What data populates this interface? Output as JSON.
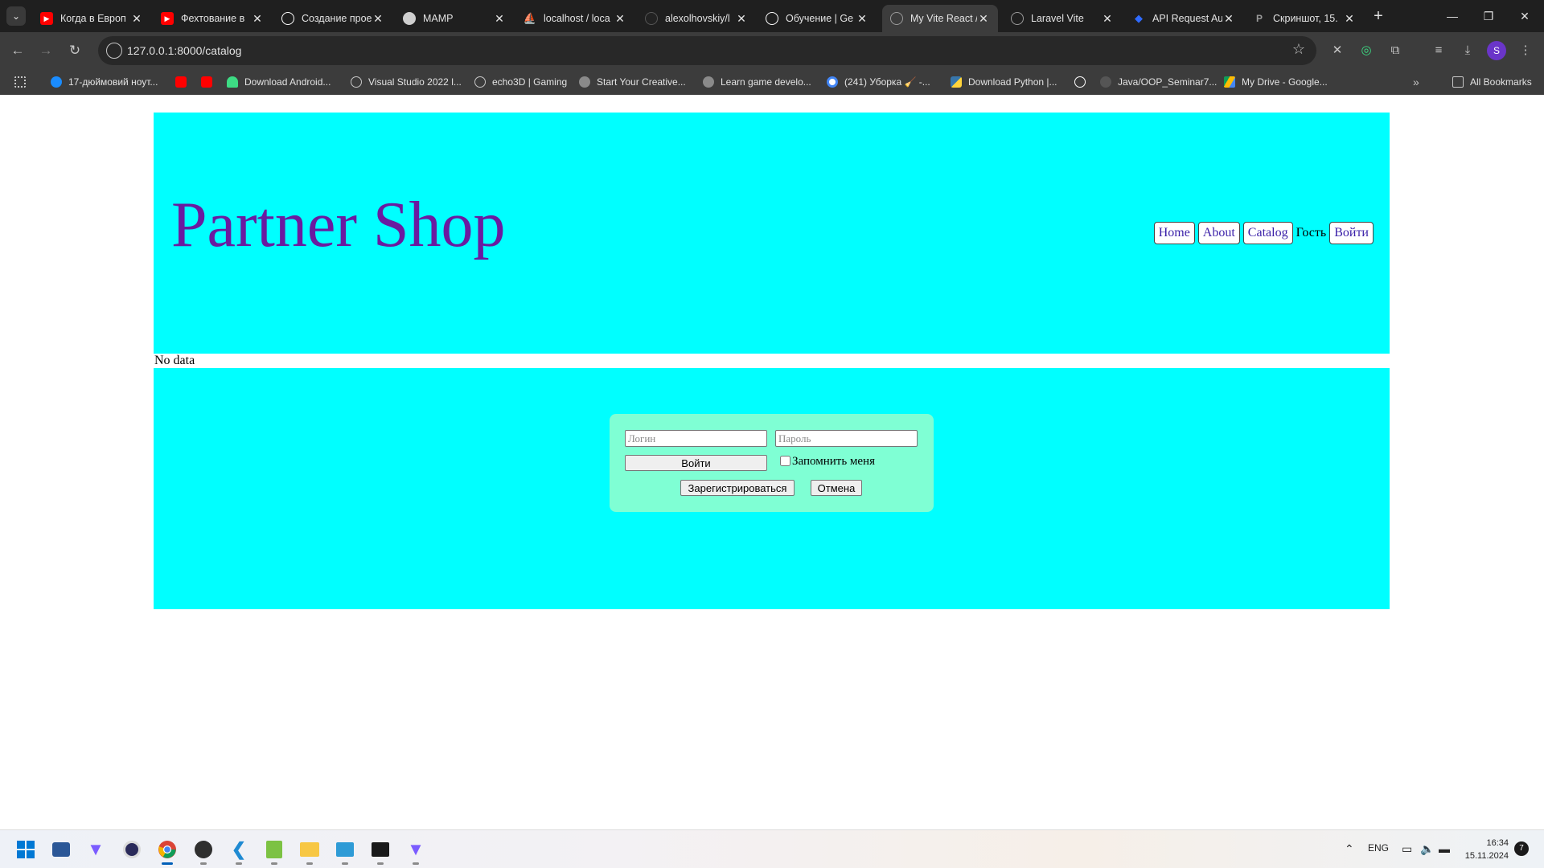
{
  "browser": {
    "tabs": [
      {
        "title": "Когда в Европ",
        "favicon": "youtube-icon",
        "color": "#ff0000",
        "active": false
      },
      {
        "title": "Фехтование в",
        "favicon": "youtube-icon",
        "color": "#ff0000",
        "active": false
      },
      {
        "title": "Создание прое",
        "favicon": "chatgpt-icon",
        "color": "#ffffff",
        "active": false
      },
      {
        "title": "MAMP",
        "favicon": "mamp-icon",
        "color": "#cfcfcf",
        "active": false
      },
      {
        "title": "localhost / loca",
        "favicon": "phpmyadmin-icon",
        "color": "#f29111",
        "active": false
      },
      {
        "title": "alexolhovskiy/l",
        "favicon": "github-icon",
        "color": "#222222",
        "active": false
      },
      {
        "title": "Обучение | Ge",
        "favicon": "chatgpt-icon",
        "color": "#ffffff",
        "active": false
      },
      {
        "title": "My Vite React /",
        "favicon": "globe-icon",
        "color": "#9a9a9a",
        "active": true
      },
      {
        "title": "Laravel Vite",
        "favicon": "globe-icon",
        "color": "#9a9a9a",
        "active": false
      },
      {
        "title": "API Request Au",
        "favicon": "dropbox-icon",
        "color": "#2f6bff",
        "active": false
      },
      {
        "title": "Скриншот, 15.",
        "favicon": "p-icon",
        "color": "#9a9a9a",
        "active": false
      }
    ],
    "url": "127.0.0.1:8000/catalog",
    "profile_initial": "S",
    "bookmarks": [
      {
        "label": "17-дюймовий ноут...",
        "icon": "hp-icon",
        "color": "#1a8cff"
      },
      {
        "label": "",
        "icon": "youtube-icon",
        "color": "#ff0000"
      },
      {
        "label": "",
        "icon": "youtube-icon",
        "color": "#ff0000"
      },
      {
        "label": "Download Android...",
        "icon": "android-icon",
        "color": "#3ddc84"
      },
      {
        "label": "Visual Studio 2022 l...",
        "icon": "globe-icon",
        "color": "#c7c7c7"
      },
      {
        "label": "echo3D | Gaming",
        "icon": "globe-icon",
        "color": "#c7c7c7"
      },
      {
        "label": "Start Your Creative...",
        "icon": "unity-icon",
        "color": "#c7c7c7"
      },
      {
        "label": "Learn game develo...",
        "icon": "unity-icon",
        "color": "#c7c7c7"
      },
      {
        "label": "(241) Уборка 🧹 -...",
        "icon": "google-icon",
        "color": "#ffffff"
      },
      {
        "label": "Download Python |...",
        "icon": "python-icon",
        "color": "#3776ab"
      },
      {
        "label": "",
        "icon": "chatgpt-icon",
        "color": "#ffffff"
      },
      {
        "label": "Java/OOP_Seminar7...",
        "icon": "github-icon",
        "color": "#555555"
      },
      {
        "label": "My Drive - Google...",
        "icon": "drive-icon",
        "color": "#fbbc04"
      }
    ],
    "all_bookmarks_label": "All Bookmarks"
  },
  "site": {
    "title": "Partner Shop",
    "nav": {
      "home": "Home",
      "about": "About",
      "catalog": "Catalog",
      "guest": "Гость",
      "login": "Войти"
    },
    "no_data": "No data",
    "login_form": {
      "login_placeholder": "Логин",
      "password_placeholder": "Пароль",
      "submit_label": "Войти",
      "remember_label": "Запомнить меня",
      "register_label": "Зарегистрироваться",
      "cancel_label": "Отмена"
    },
    "colors": {
      "header_bg": "#00ffff",
      "title_color": "#6a1ba0",
      "form_bg": "#7fffd4"
    }
  },
  "taskbar": {
    "apps": [
      "windows-start-icon",
      "powershell-icon",
      "vpn-icon",
      "app-icon",
      "chrome-icon",
      "github-desktop-icon",
      "vscode-icon",
      "notepad-icon",
      "file-explorer-icon",
      "remote-desktop-icon",
      "terminal-icon",
      "vpn-connected-icon"
    ],
    "lang": "ENG",
    "time": "16:34",
    "date": "15.11.2024",
    "notifications": "7"
  }
}
